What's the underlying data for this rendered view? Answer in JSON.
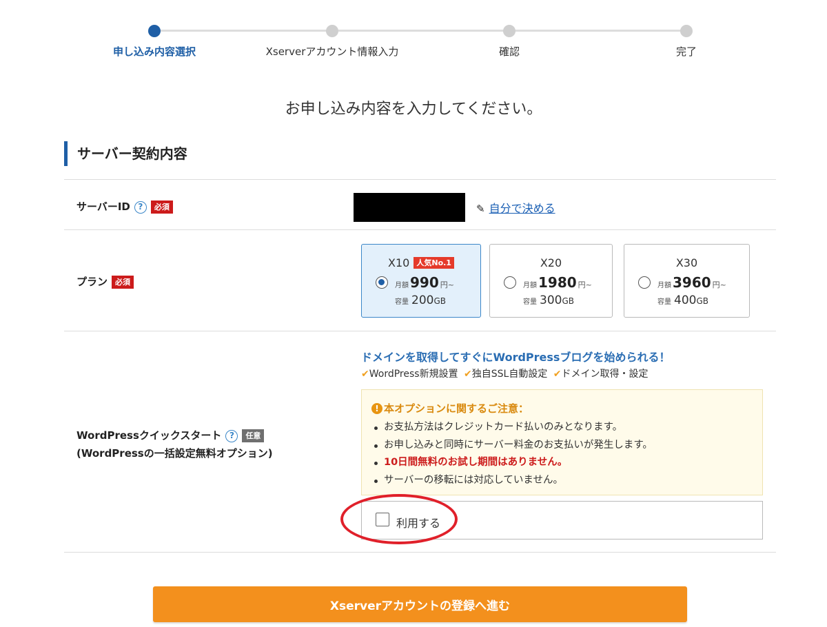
{
  "progress": {
    "steps": [
      {
        "label": "申し込み内容選択",
        "state": "active"
      },
      {
        "label": "Xserverアカウント情報入力",
        "state": "pending"
      },
      {
        "label": "確認",
        "state": "pending"
      },
      {
        "label": "完了",
        "state": "pending"
      }
    ],
    "current_step": 1,
    "total_steps": 4
  },
  "lead": "お申し込み内容を入力してください。",
  "section": {
    "title": "サーバー契約内容"
  },
  "server_id": {
    "label": "サーバーID",
    "help": "?",
    "required_badge": "必須",
    "custom_link": "自分で決める",
    "custom_link_icon": "pencil-icon"
  },
  "plan": {
    "label": "プラン",
    "required_badge": "必須",
    "options": [
      {
        "name": "X10",
        "badge": "人気No.1",
        "monthly_label": "月額",
        "price": "990",
        "price_unit": "円~",
        "capacity_label": "容量",
        "capacity": "200",
        "capacity_unit": "GB",
        "selected": true
      },
      {
        "name": "X20",
        "badge": "",
        "monthly_label": "月額",
        "price": "1980",
        "price_unit": "円~",
        "capacity_label": "容量",
        "capacity": "300",
        "capacity_unit": "GB",
        "selected": false
      },
      {
        "name": "X30",
        "badge": "",
        "monthly_label": "月額",
        "price": "3960",
        "price_unit": "円~",
        "capacity_label": "容量",
        "capacity": "400",
        "capacity_unit": "GB",
        "selected": false
      }
    ]
  },
  "wp_quickstart": {
    "label": "WordPressクイックスタート",
    "help": "?",
    "optional_badge": "任意",
    "sublabel": "(WordPressの一括設定無料オプション)",
    "promo": "ドメインを取得してすぐにWordPressブログを始められる！",
    "features": [
      "WordPress新規設置",
      "独自SSL自動設定",
      "ドメイン取得・設定"
    ],
    "notice": {
      "title": "本オプションに関するご注意：",
      "items": [
        "お支払方法はクレジットカード払いのみとなります。",
        "お申し込みと同時にサーバー料金のお支払いが発生します。",
        "10日間無料のお試し期間はありません。",
        "サーバーの移転には対応していません。"
      ]
    },
    "use_label": "利用する",
    "use_checked": false
  },
  "submit": {
    "label": "Xserverアカウントの登録へ進む"
  },
  "colors": {
    "accent_blue": "#1f5fa6",
    "required_red": "#cc1b1b",
    "submit_orange": "#f3901d",
    "annotation_circle": "#e0202a"
  }
}
